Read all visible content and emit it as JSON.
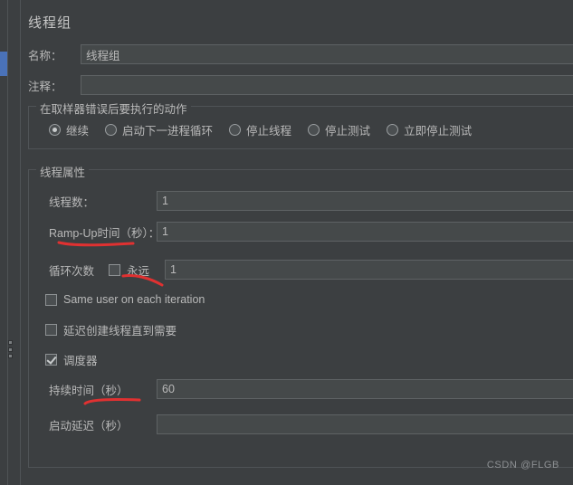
{
  "panel": {
    "title": "线程组"
  },
  "fields": {
    "name_label": "名称：",
    "name_value": "线程组",
    "comment_label": "注释：",
    "comment_value": ""
  },
  "error_action": {
    "group_title": "在取样器错误后要执行的动作",
    "options": [
      {
        "label": "继续",
        "selected": true
      },
      {
        "label": "启动下一进程循环",
        "selected": false
      },
      {
        "label": "停止线程",
        "selected": false
      },
      {
        "label": "停止测试",
        "selected": false
      },
      {
        "label": "立即停止测试",
        "selected": false
      }
    ]
  },
  "thread_properties": {
    "group_title": "线程属性",
    "threads_label": "线程数：",
    "threads_value": "1",
    "rampup_label": "Ramp-Up时间（秒）：",
    "rampup_value": "1",
    "loops_label": "循环次数",
    "forever_label": "永远",
    "forever_checked": false,
    "loops_value": "1",
    "same_user_label": "Same user on each iteration",
    "same_user_checked": false,
    "delay_create_label": "延迟创建线程直到需要",
    "delay_create_checked": false,
    "scheduler_label": "调度器",
    "scheduler_checked": true,
    "duration_label": "持续时间（秒）",
    "duration_value": "60",
    "startup_label": "启动延迟（秒）",
    "startup_value": ""
  },
  "annotations": {
    "color": "#e03131",
    "marks": [
      "rampup-underline",
      "forever-underline",
      "duration-underline"
    ]
  },
  "watermark": "CSDN @FLGB",
  "colors": {
    "background": "#3c3f41",
    "input_background": "#45494a",
    "selection_accent": "#4a72b8",
    "border": "#4f5356",
    "text": "#b9b9b9"
  }
}
